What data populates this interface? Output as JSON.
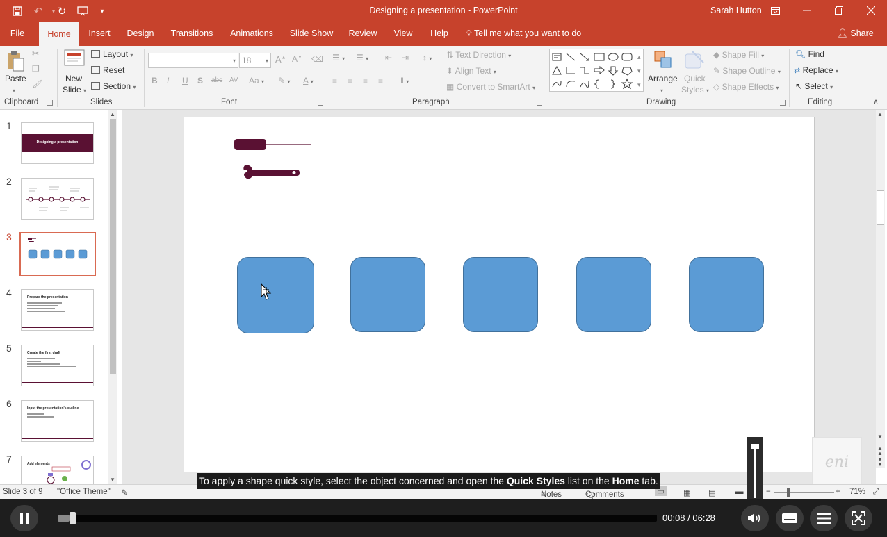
{
  "window": {
    "title": "Designing a presentation  -  PowerPoint",
    "user": "Sarah Hutton"
  },
  "tabs": [
    "File",
    "Home",
    "Insert",
    "Design",
    "Transitions",
    "Animations",
    "Slide Show",
    "Review",
    "View",
    "Help"
  ],
  "active_tab": "Home",
  "tell_me": "Tell me what you want to do",
  "share": "Share",
  "ribbon": {
    "clipboard": {
      "label": "Clipboard",
      "paste": "Paste"
    },
    "slides": {
      "label": "Slides",
      "new_slide_1": "New",
      "new_slide_2": "Slide",
      "layout": "Layout",
      "reset": "Reset",
      "section": "Section"
    },
    "font": {
      "label": "Font",
      "font_name": "",
      "font_size": "18"
    },
    "paragraph": {
      "label": "Paragraph",
      "text_direction": "Text Direction",
      "align_text": "Align Text",
      "convert_smartart": "Convert to SmartArt"
    },
    "drawing": {
      "label": "Drawing",
      "arrange": "Arrange",
      "quick_styles_1": "Quick",
      "quick_styles_2": "Styles",
      "shape_fill": "Shape Fill",
      "shape_outline": "Shape Outline",
      "shape_effects": "Shape Effects"
    },
    "editing": {
      "label": "Editing",
      "find": "Find",
      "replace": "Replace",
      "select": "Select"
    }
  },
  "thumbnails": [
    {
      "num": "1",
      "title": "Designing a presentation"
    },
    {
      "num": "2",
      "title": ""
    },
    {
      "num": "3",
      "title": ""
    },
    {
      "num": "4",
      "title": "Prepare the presentation"
    },
    {
      "num": "5",
      "title": "Create the first draft"
    },
    {
      "num": "6",
      "title": "Input the presentation's outline"
    },
    {
      "num": "7",
      "title": "Add elements"
    }
  ],
  "status": {
    "slide_info": "Slide 3 of 9",
    "theme": "\"Office Theme\"",
    "notes": "Notes",
    "comments": "Comments",
    "zoom": "71%"
  },
  "caption": {
    "part1": "To apply a shape quick style, select the object concerned and open the ",
    "bold1": "Quick Styles",
    "part2": " list on the ",
    "bold2": "Home",
    "part3": " tab."
  },
  "player": {
    "time": "00:08 / 06:28",
    "progress": 0.02
  },
  "watermark": "eni",
  "colors": {
    "accent": "#c7422c",
    "shape_fill": "#5b9bd5",
    "icon_dark": "#5a1133"
  }
}
